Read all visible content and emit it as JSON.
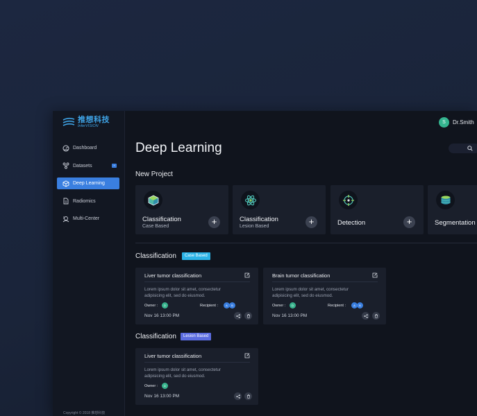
{
  "brand": {
    "name_cn": "推想科技",
    "name_en": "InferVISION"
  },
  "sidebar": {
    "items": [
      {
        "label": "Dashboard",
        "icon": "dashboard-icon"
      },
      {
        "label": "Datasets",
        "icon": "datasets-icon",
        "badge": "+"
      },
      {
        "label": "Deep Learning",
        "icon": "cube-icon",
        "active": true
      },
      {
        "label": "Radiomics",
        "icon": "document-icon"
      },
      {
        "label": "Multi-Center",
        "icon": "multi-center-icon"
      }
    ],
    "copyright": "Copyright © 2018 推想科技"
  },
  "header": {
    "user_initial": "S",
    "user_name": "Dr.Smith"
  },
  "page": {
    "title": "Deep Learning"
  },
  "new_project": {
    "title": "New Project",
    "cards": [
      {
        "title": "Classification",
        "subtitle": "Case Based",
        "icon": "cube-icon"
      },
      {
        "title": "Classification",
        "subtitle": "Lesion Based",
        "icon": "atom-icon"
      },
      {
        "title": "Detection",
        "subtitle": "",
        "icon": "crosshair-icon"
      },
      {
        "title": "Segmentation",
        "subtitle": "",
        "icon": "layers-icon"
      }
    ]
  },
  "groups": [
    {
      "title": "Classification",
      "tag": "Case Based",
      "tag_color": "#2bb3e6",
      "tasks": [
        {
          "title": "Liver tumor classification",
          "desc": "Lorem ipsum dolor sit amet, consectetur adipisicing elit, sed do eiusmod.",
          "owner_label": "Owner :",
          "owner_initial": "D",
          "recipient_label": "Recipient :",
          "recipients": [
            "A",
            "B"
          ],
          "date": "Nov 16 13:00 PM"
        },
        {
          "title": "Brain tumor classification",
          "desc": "Lorem ipsum dolor sit amet, consectetur adipisicing elit, sed do eiusmod.",
          "owner_label": "Owner :",
          "owner_initial": "D",
          "recipient_label": "Recipient :",
          "recipients": [
            "A",
            "B"
          ],
          "date": "Nov 16 13:00 PM"
        }
      ]
    },
    {
      "title": "Classification",
      "tag": "Lesion Based",
      "tag_color": "#5b6ce0",
      "tasks": [
        {
          "title": "Liver tumor classification",
          "desc": "Lorem ipsum dolor sit amet, consectetur adipisicing elit, sed do eiusmod.",
          "owner_label": "Owner :",
          "owner_initial": "D",
          "date": "Nov 16 13:00 PM"
        }
      ]
    }
  ],
  "colors": {
    "accent": "#3a7fe0",
    "avatar": "#34b48f",
    "owner": "#38b38d"
  }
}
